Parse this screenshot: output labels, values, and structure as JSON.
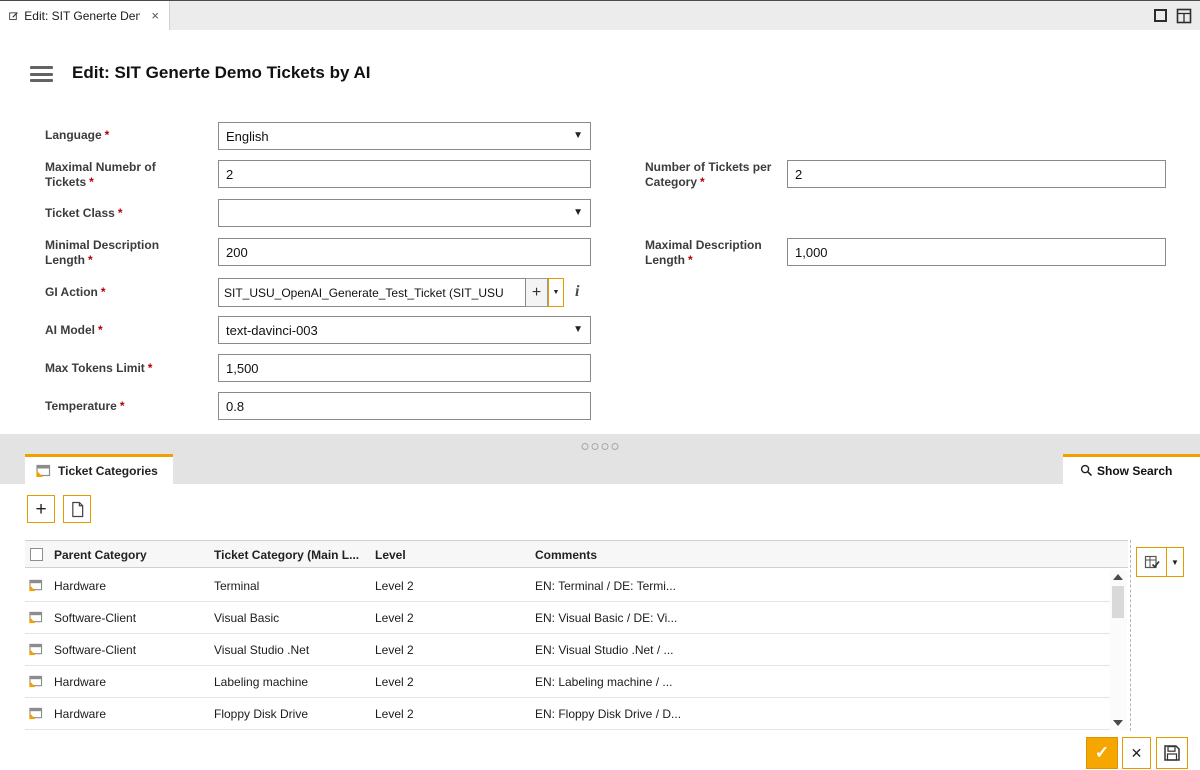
{
  "window": {
    "tab_title": "Edit: SIT Generte Demo Tick...",
    "close": "×"
  },
  "header": {
    "title": "Edit: SIT Generte Demo Tickets by AI"
  },
  "icons": {
    "caret_down": "▼",
    "small_caret": "▼",
    "plus": "+",
    "info": "i",
    "close": "×",
    "check": "✓",
    "cancel": "✕",
    "add": "+"
  },
  "form": {
    "required": "*",
    "left": [
      {
        "label": "Language",
        "value": "English"
      },
      {
        "label": "Maximal Numebr of Tickets",
        "value": "2"
      },
      {
        "label": "Ticket Class",
        "value": ""
      },
      {
        "label": "Minimal Description Length",
        "value": "200"
      },
      {
        "label": "GI Action",
        "value": "SIT_USU_OpenAI_Generate_Test_Ticket (SIT_USU"
      },
      {
        "label": "AI Model",
        "value": "text-davinci-003"
      },
      {
        "label": "Max Tokens Limit",
        "value": "1,500"
      },
      {
        "label": "Temperature",
        "value": "0.8"
      }
    ],
    "right": [
      {
        "label": "Number of Tickets per Category",
        "value": "2"
      },
      {
        "label": "Maximal Description Length",
        "value": "1,000"
      }
    ]
  },
  "section": {
    "tab_label": "Ticket Categories",
    "show_search_label": "Show Search"
  },
  "table": {
    "columns": [
      "Parent Category",
      "Ticket Category (Main L...",
      "Level",
      "Comments"
    ],
    "rows": [
      {
        "parent": "Hardware",
        "category": "Terminal",
        "level": "Level 2",
        "comments": "EN: Terminal / DE: Termi..."
      },
      {
        "parent": "Software-Client",
        "category": "Visual Basic",
        "level": "Level 2",
        "comments": "EN: Visual Basic / DE: Vi..."
      },
      {
        "parent": "Software-Client",
        "category": "Visual Studio .Net",
        "level": "Level 2",
        "comments": "EN: Visual Studio .Net / ..."
      },
      {
        "parent": "Hardware",
        "category": "Labeling machine",
        "level": "Level 2",
        "comments": "EN: Labeling machine / ..."
      },
      {
        "parent": "Hardware",
        "category": "Floppy Disk Drive",
        "level": "Level 2",
        "comments": "EN: Floppy Disk Drive / D..."
      }
    ]
  },
  "colors": {
    "accent": "#F0A000"
  }
}
